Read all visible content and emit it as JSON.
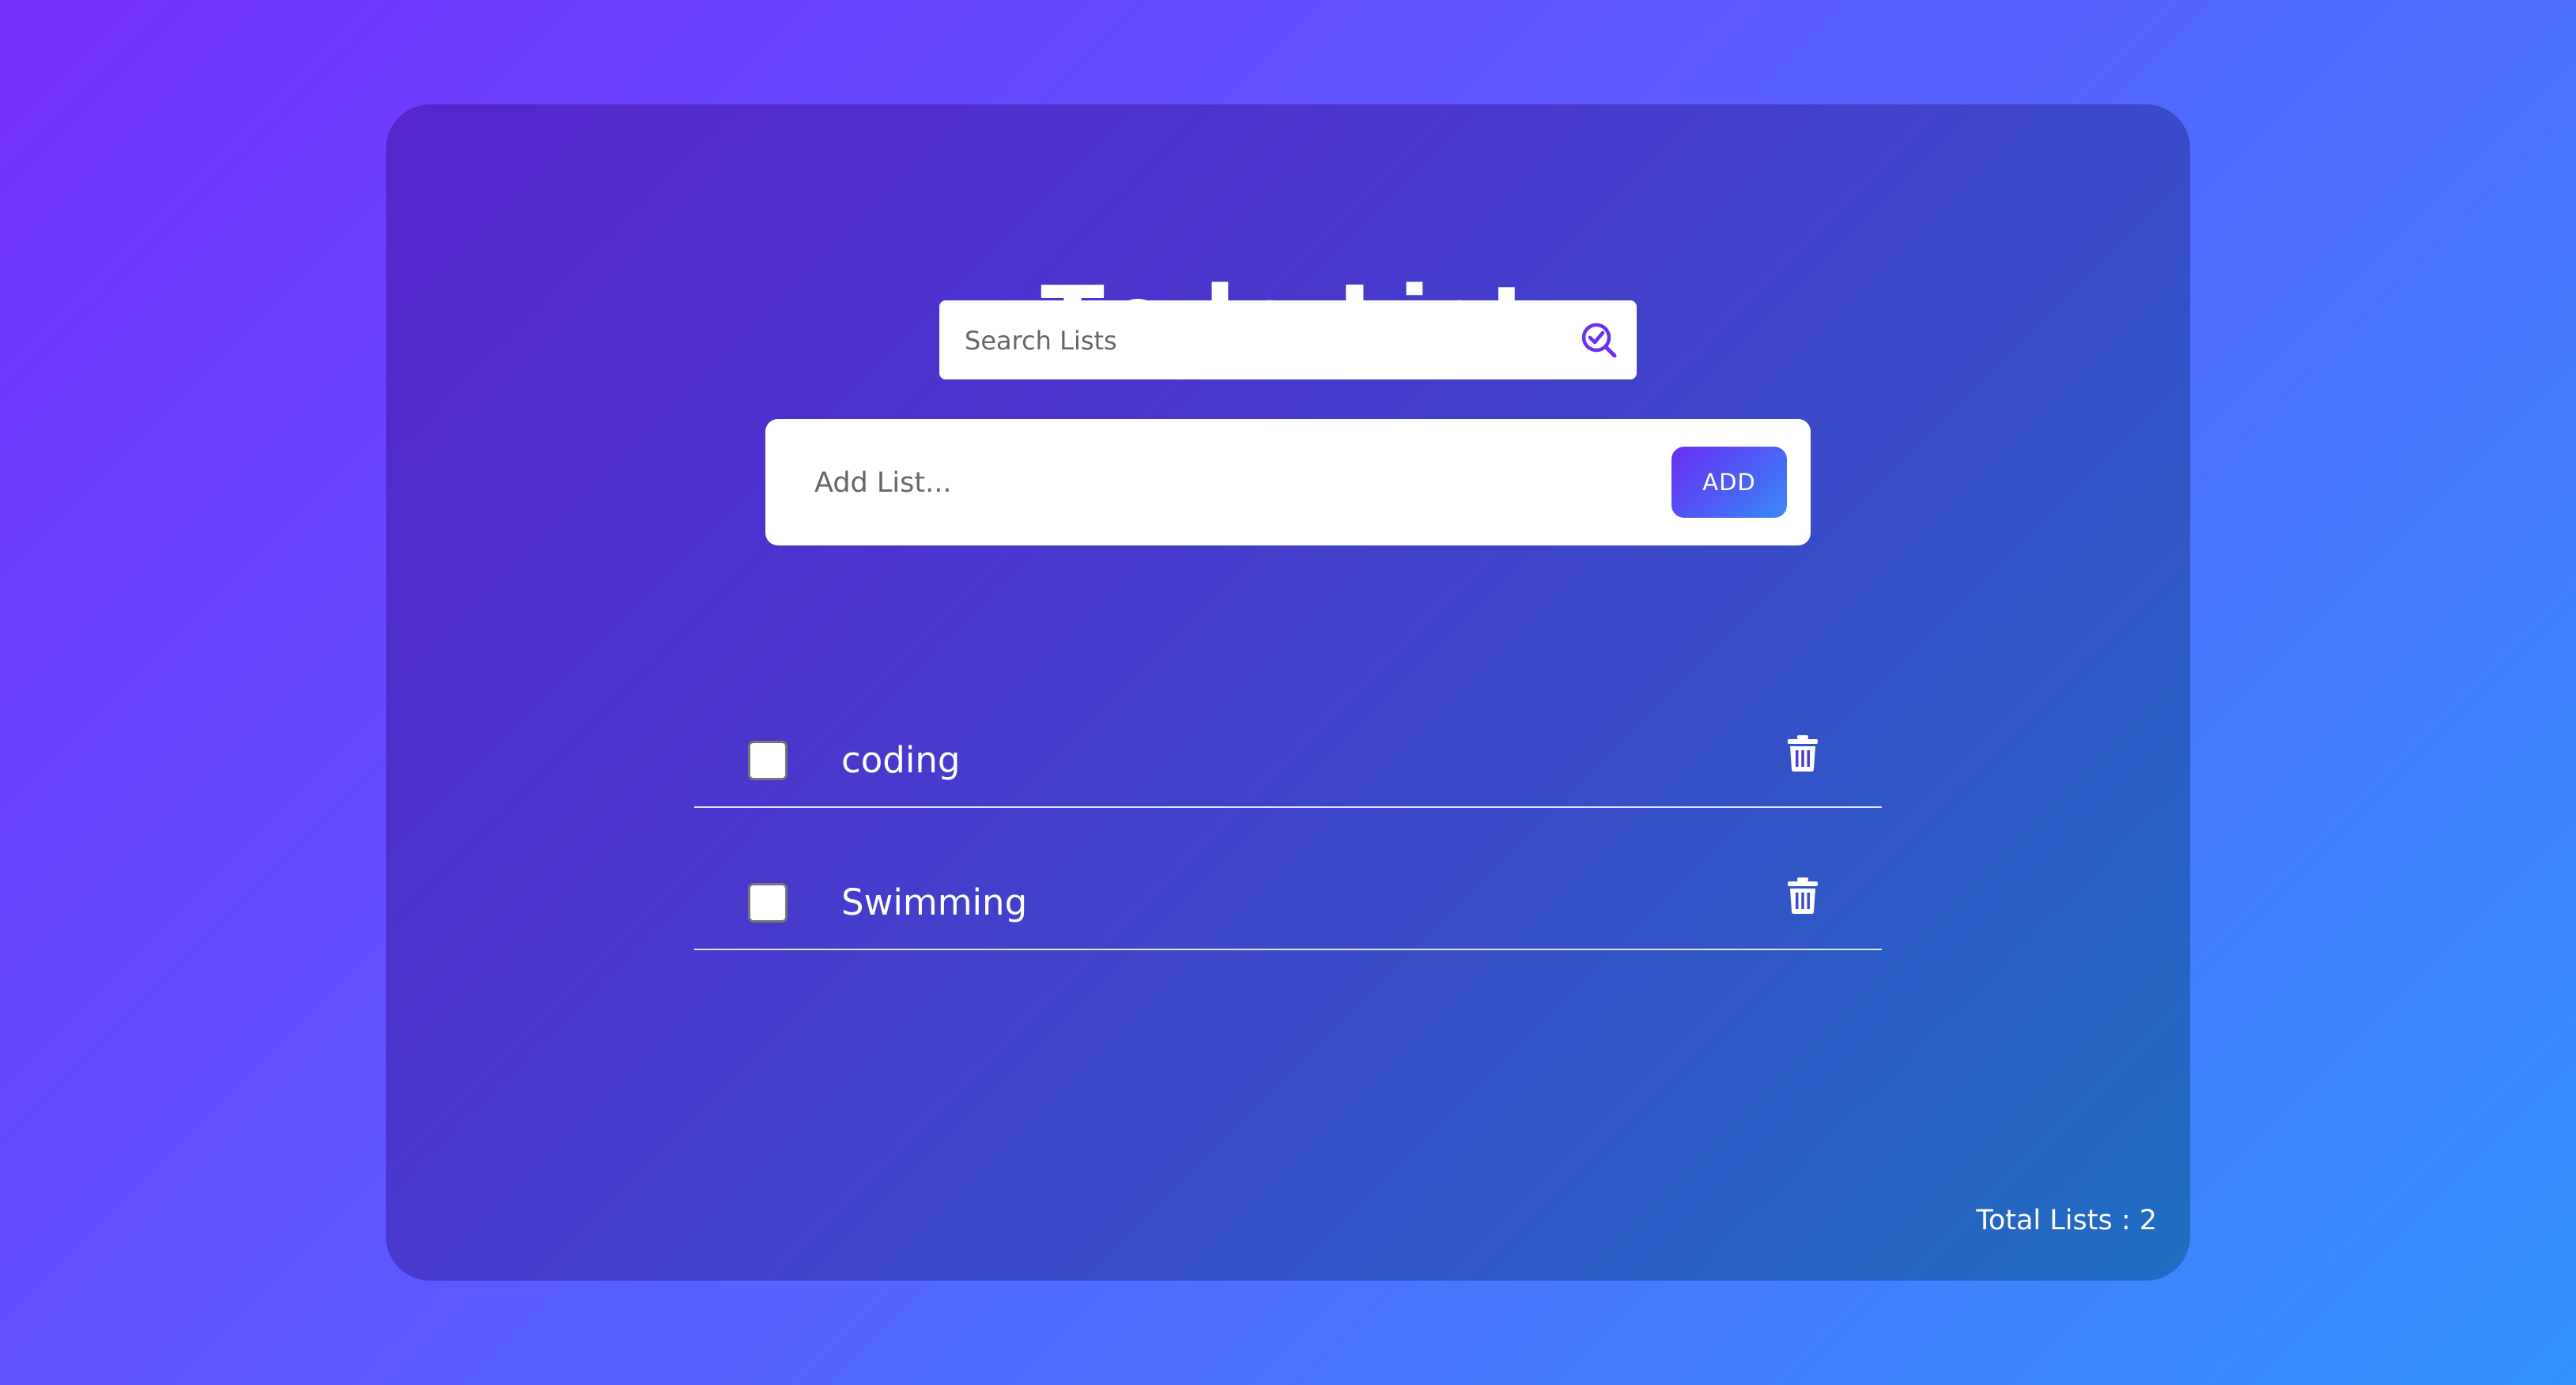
{
  "title": {
    "part_before": "T",
    "part_after": "do List",
    "icon": "check-circle-icon"
  },
  "search": {
    "placeholder": "Search Lists",
    "value": "",
    "icon": "search-check-icon"
  },
  "add_form": {
    "placeholder": "Add List...",
    "value": "",
    "button_label": "ADD"
  },
  "items": [
    {
      "label": "coding",
      "checked": false,
      "delete_icon": "trash-icon"
    },
    {
      "label": "Swimming",
      "checked": false,
      "delete_icon": "trash-icon"
    }
  ],
  "footer": {
    "total_label": "Total Lists : 2"
  },
  "colors": {
    "background_start": "#7530fd",
    "background_end": "#3293fb",
    "card_start": "#5625cc",
    "card_end": "#1f6ec2",
    "accent": "#6a2ff5",
    "text_on_dark": "#ffffff"
  }
}
